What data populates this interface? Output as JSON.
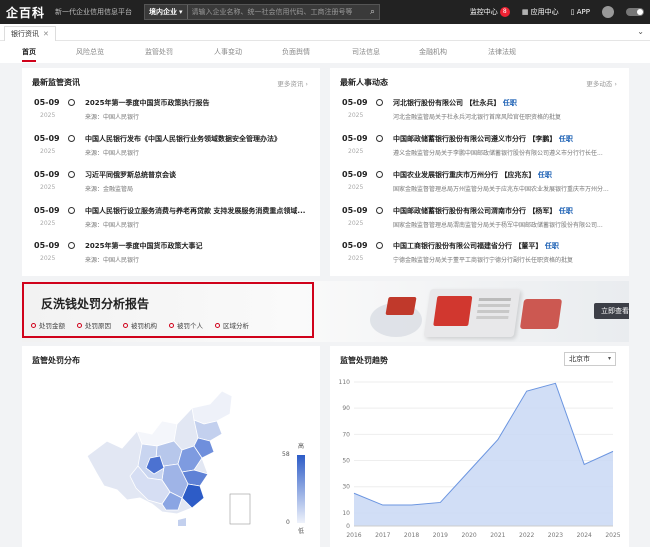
{
  "topbar": {
    "logo": "企百科",
    "slogan": "新一代企业信用信息平台",
    "scope": "境内企业",
    "search_placeholder": "请输入企业名称、统一社会信用代码、工商注册号等",
    "links": [
      "监控中心",
      "应用中心",
      "APP"
    ],
    "badge": "8"
  },
  "tab": {
    "label": "银行资讯"
  },
  "nav": [
    "首页",
    "风险总览",
    "监管处罚",
    "人事变动",
    "负面舆情",
    "司法信息",
    "金融机构",
    "法律法规"
  ],
  "news": {
    "title": "最新监管资讯",
    "more": "更多资讯 ›",
    "items": [
      {
        "date": "05-09",
        "year": "2025",
        "title": "2025年第一季度中国货币政策执行报告",
        "source": "来源：中国人民银行"
      },
      {
        "date": "05-09",
        "year": "2025",
        "title": "中国人民银行发布《中国人民银行业务领域数据安全管理办法》",
        "source": "来源：中国人民银行"
      },
      {
        "date": "05-09",
        "year": "2025",
        "title": "习近平同俄罗斯总统普京会谈",
        "source": "来源：金融监管局"
      },
      {
        "date": "05-09",
        "year": "2025",
        "title": "中国人民银行设立服务消费与养老再贷款 支持发展服务消费重点领域...",
        "source": "来源：中国人民银行"
      },
      {
        "date": "05-09",
        "year": "2025",
        "title": "2025年第一季度中国货币政策大事记",
        "source": "来源：中国人民银行"
      }
    ]
  },
  "personnel": {
    "title": "最新人事动态",
    "more": "更多动态 ›",
    "items": [
      {
        "date": "05-09",
        "year": "2025",
        "org": "河北银行股份有限公司",
        "name": "【杜永兵】",
        "tag": "任职",
        "desc": "河北金融监管局关于杜永兵河北银行首席风险官任职资格的批复"
      },
      {
        "date": "05-09",
        "year": "2025",
        "org": "中国邮政储蓄银行股份有限公司遵义市分行",
        "name": "【李鹏】",
        "tag": "任职",
        "desc": "遵义金融监管分局关于李鹏中国邮政储蓄银行股份有限公司遵义市分行行长任..."
      },
      {
        "date": "05-09",
        "year": "2025",
        "org": "中国农业发展银行重庆市万州分行",
        "name": "【应兆东】",
        "tag": "任职",
        "desc": "国家金融监督管理总局万州监管分局关于应兆东中国农业发展银行重庆市万州分..."
      },
      {
        "date": "05-09",
        "year": "2025",
        "org": "中国邮政储蓄银行股份有限公司渭南市分行",
        "name": "【杨军】",
        "tag": "任职",
        "desc": "国家金融监督管理总局渭南监管分局关于杨军中国邮政储蓄银行股份有限公司..."
      },
      {
        "date": "05-09",
        "year": "2025",
        "org": "中国工商银行股份有限公司福建省分行",
        "name": "【董平】",
        "tag": "任职",
        "desc": "宁德金融监管分局关于董平工商银行宁德分行副行长任职资格的批复"
      }
    ]
  },
  "banner": {
    "title": "反洗钱处罚分析报告",
    "links": [
      "处罚金额",
      "处罚原因",
      "被罚机构",
      "被罚个人",
      "区域分析"
    ],
    "button": "立即查看"
  },
  "map_panel": {
    "title": "监管处罚分布",
    "legend_high": "高",
    "legend_low": "低",
    "legend_max": "58",
    "legend_min": "0"
  },
  "trend_panel": {
    "title": "监管处罚趋势",
    "region": "北京市"
  },
  "colors": {
    "accent": "#d0021b",
    "chart_fill": "#c9d8f5",
    "chart_line": "#6b95e0"
  },
  "chart_data": {
    "type": "area",
    "title": "监管处罚趋势",
    "x": [
      "2016",
      "2017",
      "2018",
      "2019",
      "2020",
      "2021",
      "2022",
      "2023",
      "2024",
      "2025"
    ],
    "values": [
      25,
      16,
      16,
      18,
      42,
      66,
      103,
      109,
      47,
      57
    ],
    "ylim": [
      0,
      110
    ],
    "yticks": [
      0,
      10,
      30,
      50,
      70,
      90,
      110
    ],
    "grid": true
  }
}
